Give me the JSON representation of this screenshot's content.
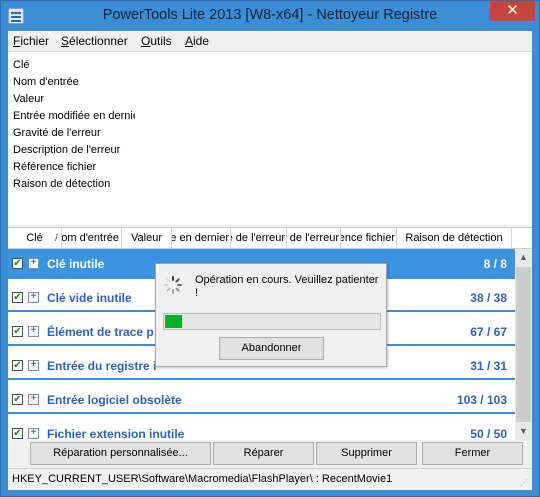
{
  "window": {
    "title": "PowerTools Lite 2013 [W8-x64] - Nettoyeur Registre",
    "close_glyph": "✕"
  },
  "menu": {
    "items": [
      {
        "first": "F",
        "rest": "ichier"
      },
      {
        "first": "S",
        "rest": "électionner"
      },
      {
        "first": "O",
        "rest": "utils"
      },
      {
        "first": "A",
        "rest": "ide"
      }
    ]
  },
  "details": {
    "lines": [
      "Clé",
      "Nom d'entrée",
      "Valeur",
      "Entrée modifiée en dernier",
      "Gravité de l'erreur",
      "Description de l'erreur",
      "Référence fichier",
      "Raison de détection"
    ]
  },
  "columns": {
    "headers": [
      "Clé",
      "Nom d'entrée",
      "Valeur",
      "Entrée modifiée en dernier",
      "Gravité de l'erreur",
      "Description de l'erreur",
      "Référence fichier",
      "Raison de détection"
    ],
    "sort_glyph": "/"
  },
  "groups": [
    {
      "title": "Clé inutile",
      "count": "8 / 8",
      "checked": true,
      "selected": true
    },
    {
      "title": "Clé vide inutile",
      "count": "38 / 38",
      "checked": true,
      "selected": false
    },
    {
      "title": "Élément de trace p",
      "count": "67 / 67",
      "checked": true,
      "selected": false
    },
    {
      "title": "Entrée du registre i",
      "count": "31 / 31",
      "checked": true,
      "selected": false
    },
    {
      "title": "Entrée logiciel obsolète",
      "count": "103 / 103",
      "checked": true,
      "selected": false
    },
    {
      "title": "Fichier extension inutile",
      "count": "50 / 50",
      "checked": true,
      "selected": false
    }
  ],
  "icons": {
    "checkbox": "checkbox-checked-icon",
    "expand": "expand-plus-icon",
    "spinner": "busy-spinner-icon",
    "scroll_up": "scroll-up-arrow-icon",
    "scroll_down": "scroll-down-arrow-icon"
  },
  "glyphs": {
    "check": "✔",
    "plus": "+",
    "up": "▲",
    "down": "▼",
    "grip": "⋰"
  },
  "buttons": {
    "custom_repair": "Réparation personnalisée...",
    "repair": "Réparer",
    "delete": "Supprimer",
    "close": "Fermer"
  },
  "status": {
    "path": "HKEY_CURRENT_USER\\Software\\Macromedia\\FlashPlayer\\ : RecentMovie1"
  },
  "dialog": {
    "message": "Opération en cours. Veuillez patienter !",
    "progress": 0.08,
    "cancel_label": "Abandonner"
  },
  "colors": {
    "title_bar": "#3c8ed4",
    "selection": "#3b94e0",
    "group_text": "#2b63b8",
    "progress": "#06b025"
  }
}
